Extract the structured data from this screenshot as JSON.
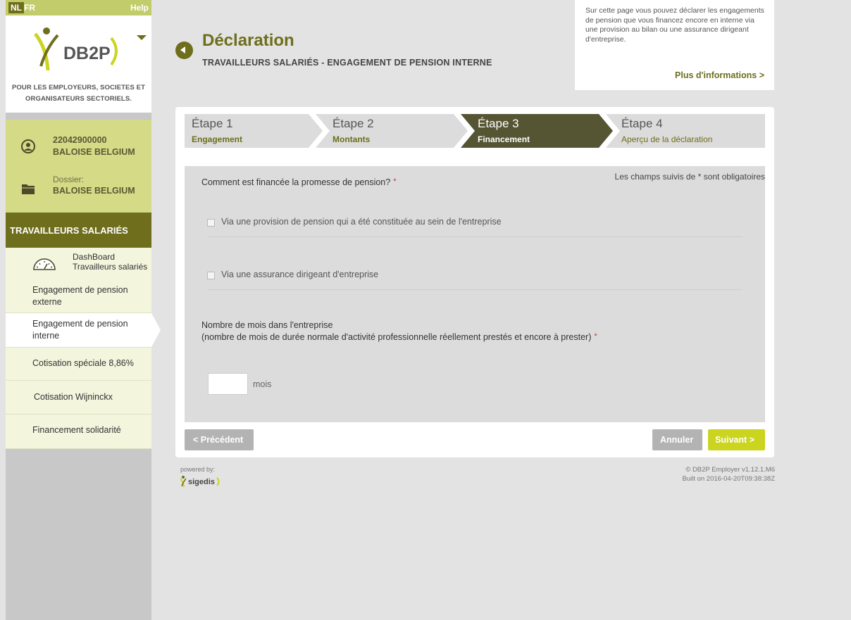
{
  "lang": {
    "nl": "NL",
    "fr": "FR",
    "help": "Help"
  },
  "logo": {
    "text": "DB2P",
    "tagline_1": "POUR LES EMPLOYEURS, SOCIETES ET",
    "tagline_2": "ORGANISATEURS SECTORIELS."
  },
  "user": {
    "number": "22042900000",
    "name": "BALOISE BELGIUM",
    "dossier_label": "Dossier:",
    "dossier_name": "BALOISE BELGIUM"
  },
  "sidebar": {
    "section_title": "TRAVAILLEURS SALARIÉS",
    "dashboard_1": "DashBoard",
    "dashboard_2": "Travailleurs salariés",
    "ext_1": "Engagement de pension",
    "ext_2": "externe",
    "int_1": "Engagement de pension",
    "int_2": "interne",
    "cotisation": "Cotisation spéciale 8,86%",
    "wijninckx": "Cotisation Wijninckx",
    "solidarite": "Financement solidarité"
  },
  "header": {
    "title": "Déclaration",
    "subtitle": "TRAVAILLEURS SALARIÉS - ENGAGEMENT DE PENSION INTERNE"
  },
  "info": {
    "text": "Sur cette page vous pouvez déclarer les engagements de pension que vous financez encore en interne via une provision au bilan ou une assurance dirigeant d'entreprise.",
    "link": "Plus d'informations >"
  },
  "steps": [
    {
      "num": "Étape 1",
      "name": "Engagement"
    },
    {
      "num": "Étape 2",
      "name": "Montants"
    },
    {
      "num": "Étape 3",
      "name": "Financement"
    },
    {
      "num": "Étape 4",
      "name": "Aperçu de la déclaration"
    }
  ],
  "form": {
    "required_note": "Les champs suivis de * sont obligatoires",
    "question_1": "Comment est financée la promesse de pension?",
    "required_mark": "*",
    "option_1": "Via une provision de pension qui a été constituée au sein de l'entreprise",
    "option_2": "Via une assurance dirigeant d'entreprise",
    "question_2_line1": "Nombre de mois dans l'entreprise",
    "question_2_line2": "(nombre de mois de durée normale d'activité professionnelle réellement prestés et encore à prester)",
    "months_value": "",
    "months_unit": "mois"
  },
  "buttons": {
    "previous": "< Précédent",
    "cancel": "Annuler",
    "next": "Suivant >"
  },
  "footer": {
    "powered_by": "powered by:",
    "sigedis": "sigedis",
    "copyright": "© DB2P Employer v1.12.1.M6",
    "built": "Built on 2016-04-20T09:38:38Z"
  },
  "colors": {
    "brand_dark": "#6e6e1d",
    "brand_light": "#cbd41f",
    "active_step": "#555533"
  }
}
